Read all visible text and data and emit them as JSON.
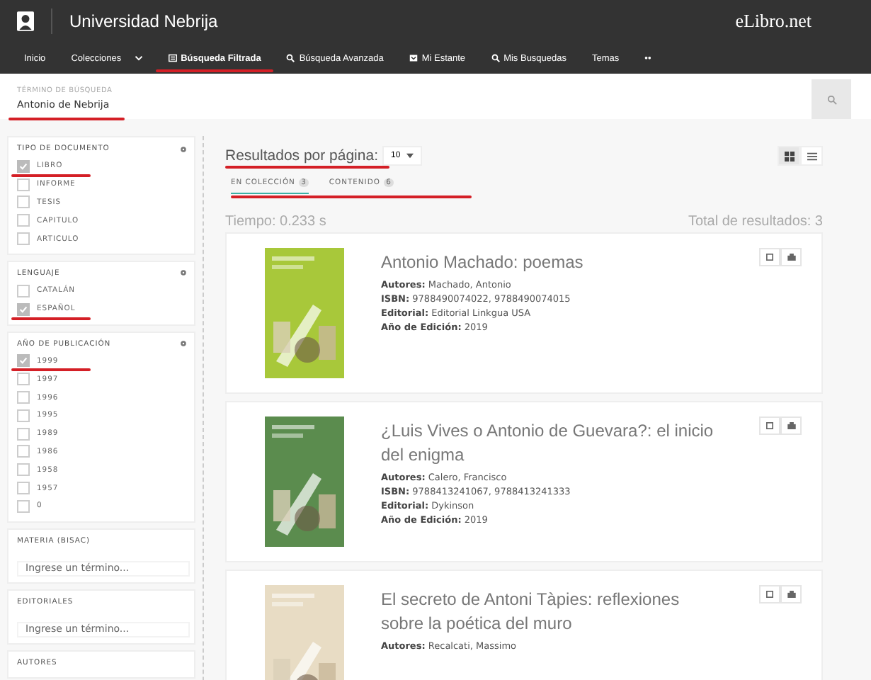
{
  "header": {
    "institution": "Universidad Nebrija",
    "brand": "eLibro.net"
  },
  "nav": [
    {
      "label": "Inicio",
      "kind": "plain",
      "selected": false,
      "marked": false
    },
    {
      "label": "Colecciones",
      "kind": "dropdown",
      "selected": false,
      "marked": false
    },
    {
      "label": "Búsqueda Filtrada",
      "kind": "filter",
      "selected": true,
      "marked": true
    },
    {
      "label": "Búsqueda Avanzada",
      "kind": "search",
      "selected": false,
      "marked": false
    },
    {
      "label": "Mi Estante",
      "kind": "shelf",
      "selected": false,
      "marked": false
    },
    {
      "label": "Mis Busquedas",
      "kind": "search",
      "selected": false,
      "marked": false
    },
    {
      "label": "Temas",
      "kind": "plain",
      "selected": false,
      "marked": false
    },
    {
      "label": "••",
      "kind": "plain",
      "selected": false,
      "marked": false
    }
  ],
  "search": {
    "label": "TÉRMINO DE BÚSQUEDA",
    "value": "Antonio de Nebrija",
    "marked": true
  },
  "filters": [
    {
      "kind": "checklist",
      "title": "TIPO DE DOCUMENTO",
      "items": [
        {
          "label": "LIBRO",
          "checked": true,
          "marked": true
        },
        {
          "label": "INFORME",
          "checked": false,
          "marked": false
        },
        {
          "label": "TESIS",
          "checked": false,
          "marked": false
        },
        {
          "label": "CAPITULO",
          "checked": false,
          "marked": false
        },
        {
          "label": "ARTICULO",
          "checked": false,
          "marked": false
        }
      ]
    },
    {
      "kind": "checklist",
      "title": "LENGUAJE",
      "items": [
        {
          "label": "CATALÁN",
          "checked": false,
          "marked": false
        },
        {
          "label": "ESPAÑOL",
          "checked": true,
          "marked": true
        }
      ]
    },
    {
      "kind": "checklist",
      "title": "AÑO DE PUBLICACIÓN",
      "items": [
        {
          "label": "1999",
          "checked": true,
          "marked": true
        },
        {
          "label": "1997",
          "checked": false,
          "marked": false
        },
        {
          "label": "1996",
          "checked": false,
          "marked": false
        },
        {
          "label": "1995",
          "checked": false,
          "marked": false
        },
        {
          "label": "1989",
          "checked": false,
          "marked": false
        },
        {
          "label": "1986",
          "checked": false,
          "marked": false
        },
        {
          "label": "1958",
          "checked": false,
          "marked": false
        },
        {
          "label": "1957",
          "checked": false,
          "marked": false
        },
        {
          "label": "0",
          "checked": false,
          "marked": false
        }
      ]
    },
    {
      "kind": "input",
      "title": "MATERIA (BISAC)",
      "placeholder": "Ingrese un término..."
    },
    {
      "kind": "input",
      "title": "EDITORIALES",
      "placeholder": "Ingrese un término..."
    },
    {
      "kind": "input",
      "title": "AUTORES"
    }
  ],
  "results_per_page": {
    "label": "Resultados por página:",
    "value": "10",
    "marked": true
  },
  "tabs": [
    {
      "label": "EN COLECCIÓN",
      "count": "3",
      "selected": true
    },
    {
      "label": "CONTENIDO",
      "count": "6",
      "selected": false
    }
  ],
  "tabs_marked": true,
  "view": [
    {
      "kind": "grid",
      "selected": true
    },
    {
      "kind": "list",
      "selected": false
    }
  ],
  "time": "Tiempo: 0.233 s",
  "total": "Total de resultados: 3",
  "results": [
    {
      "title": "Antonio Machado: poemas",
      "fields": [
        {
          "label": "Autores:",
          "value": "Machado, Antonio"
        },
        {
          "label": "ISBN:",
          "value": "9788490074022, 9788490074015"
        },
        {
          "label": "Editorial:",
          "value": "Editorial Linkgua USA"
        },
        {
          "label": "Año de Edición:",
          "value": "2019"
        }
      ]
    },
    {
      "title": "¿Luis Vives o Antonio de Guevara?: el inicio del enigma",
      "fields": [
        {
          "label": "Autores:",
          "value": "Calero, Francisco"
        },
        {
          "label": "ISBN:",
          "value": "9788413241067, 9788413241333"
        },
        {
          "label": "Editorial:",
          "value": "Dykinson"
        },
        {
          "label": "Año de Edición:",
          "value": "2019"
        }
      ]
    },
    {
      "title": "El secreto de Antoni Tàpies: reflexiones sobre la poética del muro",
      "fields": [
        {
          "label": "Autores:",
          "value": "Recalcati, Massimo"
        }
      ]
    }
  ]
}
